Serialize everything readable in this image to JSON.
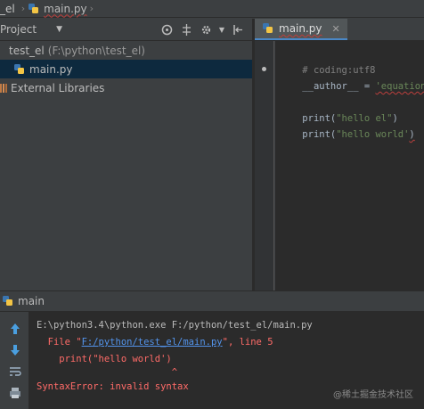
{
  "navbar": {
    "crumb": "_el",
    "file": "main.py"
  },
  "project_panel": {
    "title": "Project",
    "tree": [
      {
        "name": "test_el",
        "path": "(F:\\python\\test_el)"
      },
      {
        "name": "main.py"
      },
      {
        "name": "External Libraries"
      }
    ]
  },
  "editor": {
    "tab_label": "main.py",
    "lines": [
      {
        "comment": "# coding:utf8"
      },
      {
        "name": "__author__ = ",
        "string": "'equation'"
      },
      {
        "blank": ""
      },
      {
        "name": "print(",
        "string": "\"hello el\"",
        "tail": ")"
      },
      {
        "name": "print(",
        "string": "\"hello world'",
        "tail": ")"
      }
    ]
  },
  "run_panel": {
    "title": "main",
    "console": {
      "command": "E:\\python3.4\\python.exe F:/python/test_el/main.py",
      "file_prefix": "  File \"",
      "file_link": "F:/python/test_el/main.py",
      "file_suffix": "\", line 5",
      "code_line": "    print(\"hello world')",
      "caret_line": "                        ^",
      "error": "SyntaxError: invalid syntax"
    }
  },
  "watermark": "@稀土掘金技术社区",
  "colors": {
    "panel_bg": "#3c3f41",
    "editor_bg": "#2b2b2b",
    "selection": "#0d293e",
    "error_red": "#ff6b68",
    "link_blue": "#5394ec",
    "string_green": "#6a8759"
  }
}
